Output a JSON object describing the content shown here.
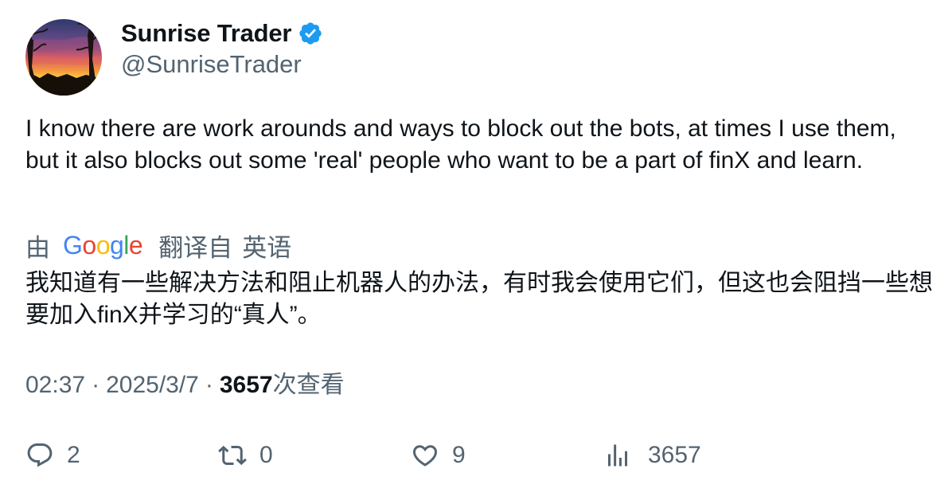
{
  "author": {
    "display_name": "Sunrise Trader",
    "handle": "@SunriseTrader",
    "verified": true,
    "avatar_icon": "sunset-avatar"
  },
  "tweet": {
    "text": "I know there are work arounds and ways to block out the bots, at times I use them, but it also blocks out some 'real' people who want to be a part of finX and learn."
  },
  "translation": {
    "by_label": "由",
    "provider": "Google",
    "translated_from": "翻译自",
    "language": "英语",
    "text": "我知道有一些解决方法和阻止机器人的办法，有时我会使用它们，但这也会阻挡一些想要加入finX并学习的“真人”。"
  },
  "meta": {
    "time": "02:37",
    "separator": "·",
    "date": "2025/3/7",
    "views_count": "3657",
    "views_label": "次查看"
  },
  "actions": {
    "reply": {
      "icon": "reply-icon",
      "count": "2"
    },
    "retweet": {
      "icon": "retweet-icon",
      "count": "0"
    },
    "like": {
      "icon": "heart-icon",
      "count": "9"
    },
    "views": {
      "icon": "analytics-icon",
      "count": "3657"
    }
  },
  "colors": {
    "verified": "#1d9bf0",
    "secondary_text": "#536471",
    "primary_text": "#0f1419"
  }
}
